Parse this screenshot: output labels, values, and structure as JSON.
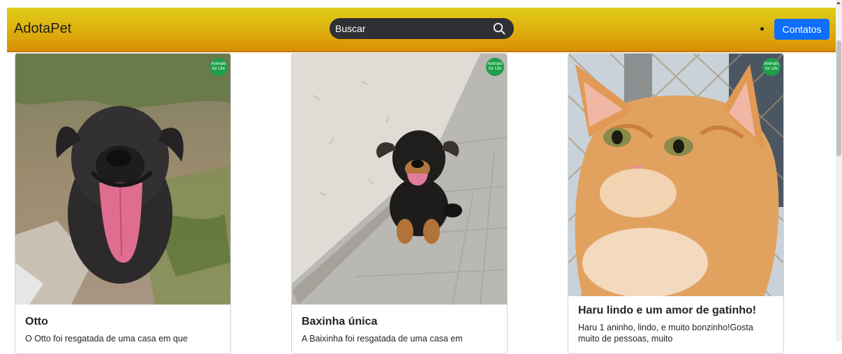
{
  "navbar": {
    "brand": "AdotaPet",
    "search_placeholder": "Buscar",
    "contact_label": "Contatos"
  },
  "cards": [
    {
      "badge": "Animals for Life",
      "title": "Otto",
      "text": "O Otto foi resgatada de uma casa em que"
    },
    {
      "badge": "Animals for Life",
      "title": "Baxinha única",
      "text": "A Baixinha foi resgatada de uma casa em"
    },
    {
      "badge": "Animals for Life",
      "title": "Haru lindo e um amor de gatinho!",
      "text": "Haru 1 aninho, lindo, e muito bonzinho!Gosta muito de pessoas, muito"
    }
  ],
  "icons": {
    "search": "search-icon",
    "scroll_up": "arrow-up-icon"
  }
}
